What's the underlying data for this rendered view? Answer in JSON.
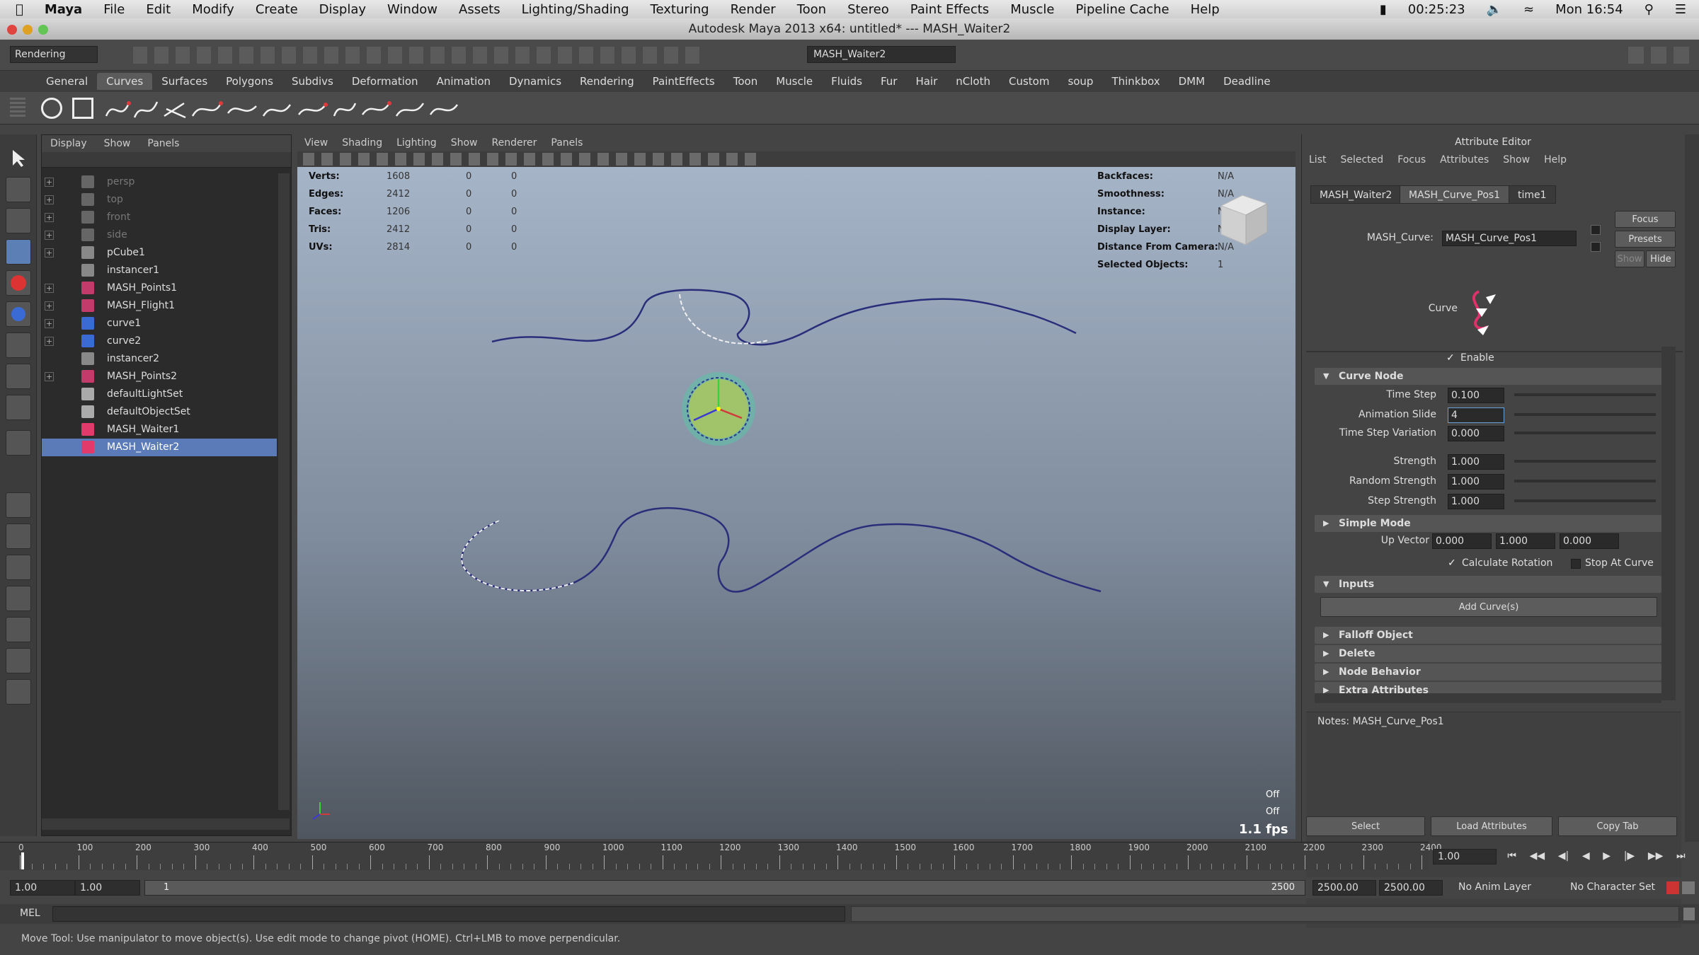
{
  "macbar": {
    "app": "Maya",
    "menus": [
      "File",
      "Edit",
      "Modify",
      "Create",
      "Display",
      "Window",
      "Assets",
      "Lighting/Shading",
      "Texturing",
      "Render",
      "Toon",
      "Stereo",
      "Paint Effects",
      "Muscle",
      "Pipeline Cache",
      "Help"
    ],
    "battery_time": "00:25:23",
    "clock": "Mon 16:54"
  },
  "window_title": "Autodesk Maya 2013 x64: untitled*   ---   MASH_Waiter2",
  "toolbar": {
    "menu_set": "Rendering",
    "name_field": "MASH_Waiter2"
  },
  "shelf_tabs": [
    "General",
    "Curves",
    "Surfaces",
    "Polygons",
    "Subdivs",
    "Deformation",
    "Animation",
    "Dynamics",
    "Rendering",
    "PaintEffects",
    "Toon",
    "Muscle",
    "Fluids",
    "Fur",
    "Hair",
    "nCloth",
    "Custom",
    "soup",
    "Thinkbox",
    "DMM",
    "Deadline"
  ],
  "outliner": {
    "menus": [
      "Display",
      "Show",
      "Panels"
    ],
    "items": [
      {
        "label": "persp",
        "expand": "+"
      },
      {
        "label": "top",
        "expand": "+"
      },
      {
        "label": "front",
        "expand": "+"
      },
      {
        "label": "side",
        "expand": "+"
      },
      {
        "label": "pCube1",
        "expand": "+"
      },
      {
        "label": "instancer1",
        "expand": ""
      },
      {
        "label": "MASH_Points1",
        "expand": "+"
      },
      {
        "label": "MASH_Flight1",
        "expand": "+"
      },
      {
        "label": "curve1",
        "expand": "+"
      },
      {
        "label": "curve2",
        "expand": "+"
      },
      {
        "label": "instancer2",
        "expand": ""
      },
      {
        "label": "MASH_Points2",
        "expand": "+"
      },
      {
        "label": "defaultLightSet",
        "expand": ""
      },
      {
        "label": "defaultObjectSet",
        "expand": ""
      },
      {
        "label": "MASH_Waiter1",
        "expand": ""
      },
      {
        "label": "MASH_Waiter2",
        "expand": ""
      }
    ]
  },
  "viewport": {
    "menus": [
      "View",
      "Shading",
      "Lighting",
      "Show",
      "Renderer",
      "Panels"
    ],
    "stats": [
      {
        "label": "Verts:",
        "v1": "1608",
        "v2": "0",
        "v3": "0"
      },
      {
        "label": "Edges:",
        "v1": "2412",
        "v2": "0",
        "v3": "0"
      },
      {
        "label": "Faces:",
        "v1": "1206",
        "v2": "0",
        "v3": "0"
      },
      {
        "label": "Tris:",
        "v1": "2412",
        "v2": "0",
        "v3": "0"
      },
      {
        "label": "UVs:",
        "v1": "2814",
        "v2": "0",
        "v3": "0"
      }
    ],
    "info": [
      {
        "label": "Backfaces:",
        "value": "N/A"
      },
      {
        "label": "Smoothness:",
        "value": "N/A"
      },
      {
        "label": "Instance:",
        "value": "N/A"
      },
      {
        "label": "Display Layer:",
        "value": "N/A"
      },
      {
        "label": "Distance From Camera:",
        "value": "N/A"
      },
      {
        "label": "Selected Objects:",
        "value": "1"
      }
    ],
    "off1": "Off",
    "off2": "Off",
    "fps": "1.1 fps"
  },
  "attribute_editor": {
    "title": "Attribute Editor",
    "menus": [
      "List",
      "Selected",
      "Focus",
      "Attributes",
      "Show",
      "Help"
    ],
    "tabs": [
      "MASH_Waiter2",
      "MASH_Curve_Pos1",
      "time1"
    ],
    "focus_button": "Focus",
    "presets_button": "Presets",
    "show_button": "Show",
    "hide_button": "Hide",
    "node_label": "MASH_Curve:",
    "node_value": "MASH_Curve_Pos1",
    "swatch_label": "Curve",
    "enable_label": "Enable",
    "section_curve_node": "Curve Node",
    "time_step_label": "Time Step",
    "time_step": "0.100",
    "anim_slide_label": "Animation Slide",
    "anim_slide": "4",
    "time_step_var_label": "Time Step Variation",
    "time_step_var": "0.000",
    "strength_label": "Strength",
    "strength": "1.000",
    "random_strength_label": "Random Strength",
    "random_strength": "1.000",
    "step_strength_label": "Step Strength",
    "step_strength": "1.000",
    "section_simple_mode": "Simple Mode",
    "up_vector_label": "Up Vector",
    "up_vector": [
      "0.000",
      "1.000",
      "0.000"
    ],
    "calc_rotation_label": "Calculate Rotation",
    "stop_at_curve_label": "Stop At Curve",
    "section_inputs": "Inputs",
    "add_curves": "Add Curve(s)",
    "section_falloff": "Falloff Object",
    "section_delete": "Delete",
    "section_node_behavior": "Node Behavior",
    "section_extra": "Extra Attributes",
    "notes": "Notes:  MASH_Curve_Pos1",
    "select_button": "Select",
    "load_button": "Load Attributes",
    "copy_button": "Copy Tab"
  },
  "timeline": {
    "ticks": [
      "0",
      "100",
      "200",
      "300",
      "400",
      "500",
      "600",
      "700",
      "800",
      "900",
      "1000",
      "1100",
      "1200",
      "1300",
      "1400",
      "1500",
      "1600",
      "1700",
      "1800",
      "1900",
      "2000",
      "2100",
      "2200",
      "2300",
      "2400"
    ],
    "current_frame": "1.00",
    "range_start": "1.00",
    "range_start2": "1.00",
    "playback_start": "1",
    "range_end_label": "2500",
    "range_end": "2500.00",
    "range_end2": "2500.00",
    "anim_layer": "No Anim Layer",
    "character_set": "No Character Set"
  },
  "mel_label": "MEL",
  "help_line": "Move Tool: Use manipulator to move object(s). Use edit mode to change pivot (HOME). Ctrl+LMB to move perpendicular.",
  "colors": {
    "selection": "#5a7ab8",
    "curve": "#2a2e7a",
    "accent": "#6aa0d8"
  }
}
